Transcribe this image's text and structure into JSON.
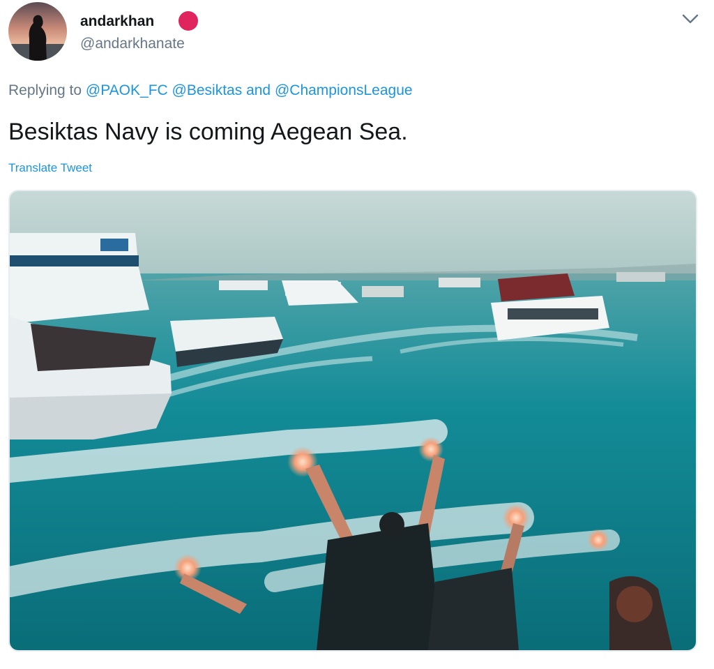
{
  "user": {
    "display_name": "andarkhan",
    "handle": "@andarkhanate",
    "badge_color": "#e0245e"
  },
  "reply": {
    "prefix": "Replying to",
    "mention_1": "@PAOK_FC",
    "mention_2": "@Besiktas",
    "conjunction": "and",
    "mention_3": "@ChampionsLeague"
  },
  "tweet": {
    "text": "Besiktas Navy is coming Aegean Sea.",
    "translate_label": "Translate Tweet"
  },
  "icons": {
    "menu": "chevron-down-icon"
  },
  "colors": {
    "link": "#1b95e0",
    "secondary_text": "#657786",
    "primary_text": "#14171a"
  }
}
